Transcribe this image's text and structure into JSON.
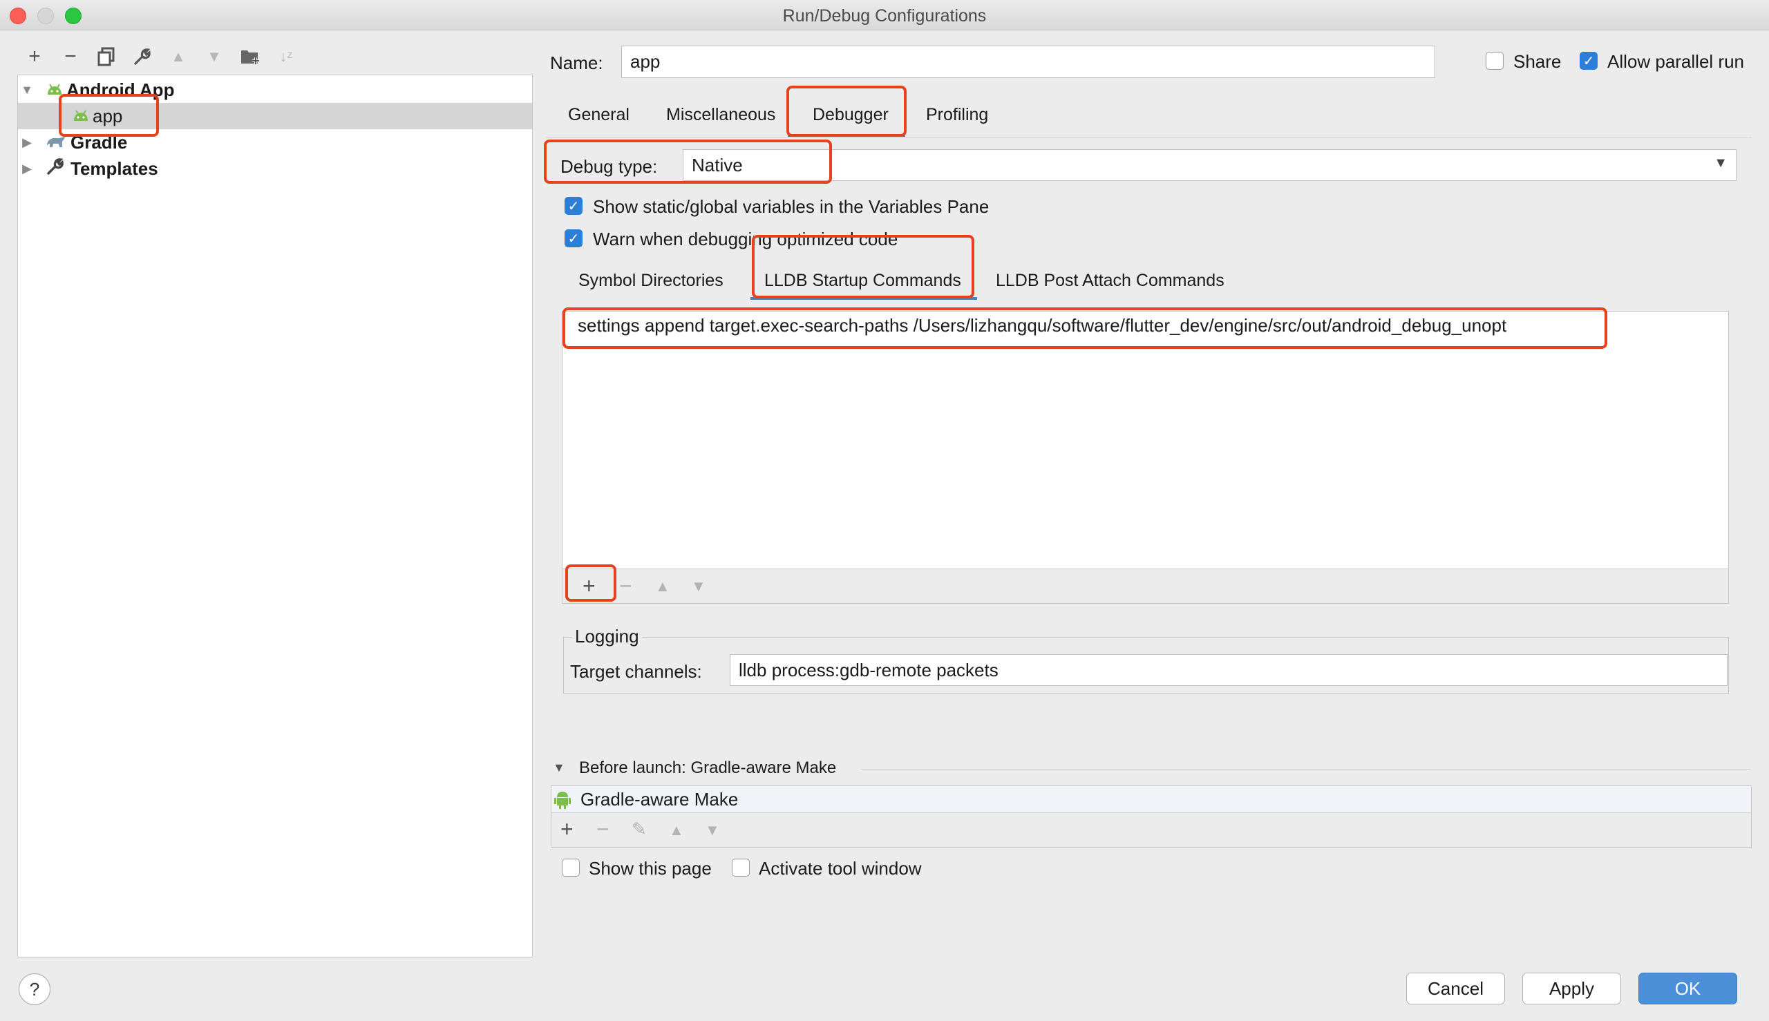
{
  "window": {
    "title": "Run/Debug Configurations"
  },
  "tree": {
    "items": [
      {
        "label": "Android App"
      },
      {
        "label": "app"
      },
      {
        "label": "Gradle"
      },
      {
        "label": "Templates"
      }
    ]
  },
  "form": {
    "name_label": "Name:",
    "name_value": "app",
    "share_label": "Share",
    "allow_parallel_label": "Allow parallel run"
  },
  "tabs": [
    "General",
    "Miscellaneous",
    "Debugger",
    "Profiling"
  ],
  "debugger": {
    "debug_type_label": "Debug type:",
    "debug_type_value": "Native",
    "show_static_label": "Show static/global variables in the Variables Pane",
    "warn_optimized_label": "Warn when debugging optimized code",
    "subtabs": [
      "Symbol Directories",
      "LLDB Startup Commands",
      "LLDB Post Attach Commands"
    ],
    "startup_command": "settings append target.exec-search-paths /Users/lizhangqu/software/flutter_dev/engine/src/out/android_debug_unopt",
    "logging_title": "Logging",
    "target_channels_label": "Target channels:",
    "target_channels_value": "lldb process:gdb-remote packets"
  },
  "before_launch": {
    "title": "Before launch: Gradle-aware Make",
    "item": "Gradle-aware Make",
    "show_page_label": "Show this page",
    "activate_tool_label": "Activate tool window"
  },
  "footer": {
    "help": "?",
    "cancel": "Cancel",
    "apply": "Apply",
    "ok": "OK"
  },
  "colors": {
    "highlight": "#e8421c",
    "accent": "#2c7ed6",
    "ok_button": "#4a8fd8",
    "android_green": "#7cbd4b"
  }
}
